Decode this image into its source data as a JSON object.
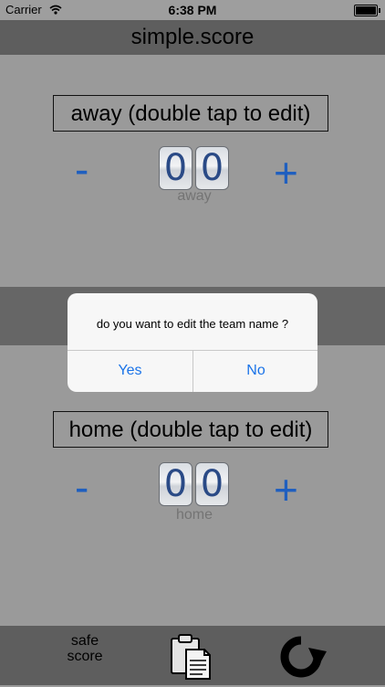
{
  "status_bar": {
    "carrier": "Carrier",
    "time": "6:38 PM"
  },
  "title": "simple.score",
  "away": {
    "name": "away (double tap to edit)",
    "digit1": "0",
    "digit2": "0",
    "label": "away",
    "minus": "-",
    "plus": "+"
  },
  "home": {
    "name": "home (double tap to edit)",
    "digit1": "0",
    "digit2": "0",
    "label": "home",
    "minus": "-",
    "plus": "+"
  },
  "dialog": {
    "message": "do you want to edit the team name ?",
    "yes": "Yes",
    "no": "No"
  },
  "bottom": {
    "logo_line1": "safe",
    "logo_line2": "score"
  },
  "icons": {
    "wifi": "wifi-icon",
    "battery": "battery-icon",
    "clipboard": "clipboard-icon",
    "refresh": "refresh-icon"
  }
}
